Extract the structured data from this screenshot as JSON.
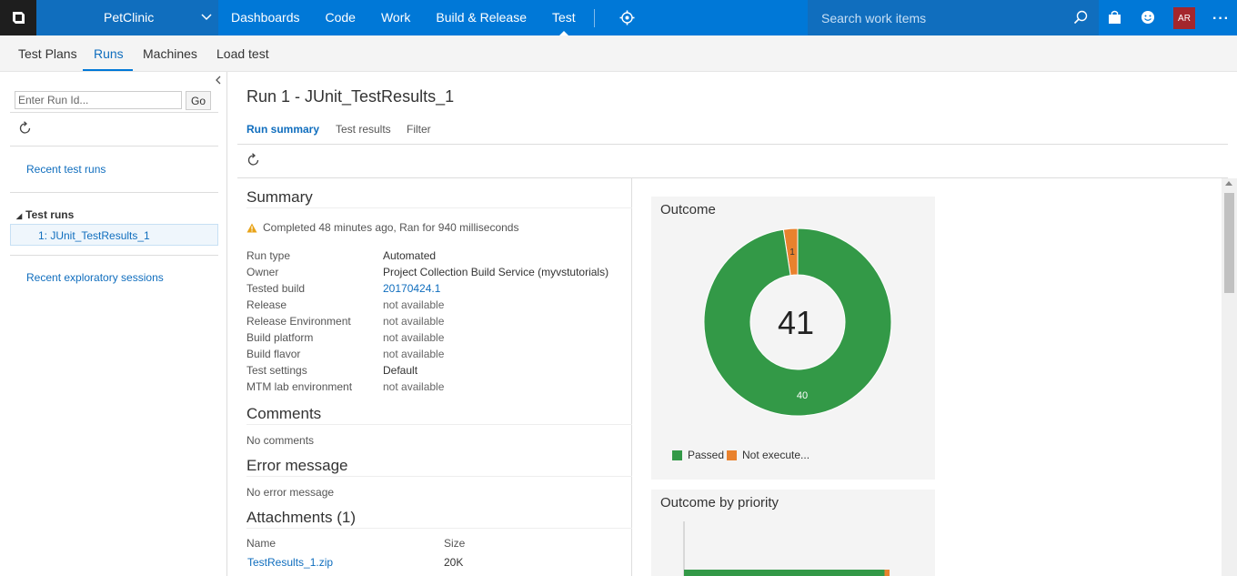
{
  "topbar": {
    "project": "PetClinic",
    "nav": [
      "Dashboards",
      "Code",
      "Work",
      "Build & Release",
      "Test"
    ],
    "active_nav": "Test",
    "search_placeholder": "Search work items",
    "avatar_initials": "AR"
  },
  "subnav": {
    "items": [
      "Test Plans",
      "Runs",
      "Machines",
      "Load test"
    ],
    "active": "Runs"
  },
  "left": {
    "run_id_placeholder": "Enter Run Id...",
    "go_label": "Go",
    "recent_test_runs": "Recent test runs",
    "test_runs_header": "Test runs",
    "selected_run": "1: JUnit_TestResults_1",
    "recent_exploratory": "Recent exploratory sessions"
  },
  "main": {
    "title": "Run 1 - JUnit_TestResults_1",
    "tabs": [
      "Run summary",
      "Test results",
      "Filter"
    ],
    "active_tab": "Run summary",
    "summary": {
      "heading": "Summary",
      "status": "Completed 48 minutes ago, Ran for 940 milliseconds",
      "fields": [
        {
          "key": "Run type",
          "value": "Automated"
        },
        {
          "key": "Owner",
          "value": "Project Collection Build Service (myvstutorials)"
        },
        {
          "key": "Tested build",
          "value": "20170424.1"
        },
        {
          "key": "Release",
          "value": "not available"
        },
        {
          "key": "Release Environment",
          "value": "not available"
        },
        {
          "key": "Build platform",
          "value": "not available"
        },
        {
          "key": "Build flavor",
          "value": "not available"
        },
        {
          "key": "Test settings",
          "value": "Default"
        },
        {
          "key": "MTM lab environment",
          "value": "not available"
        }
      ]
    },
    "comments": {
      "heading": "Comments",
      "text": "No comments"
    },
    "error": {
      "heading": "Error message",
      "text": "No error message"
    },
    "attachments": {
      "heading": "Attachments (1)",
      "col_name": "Name",
      "col_size": "Size",
      "rows": [
        {
          "name": "TestResults_1.zip",
          "size": "20K"
        }
      ]
    }
  },
  "charts": {
    "outcome_title": "Outcome",
    "outcome_by_priority_title": "Outcome by priority",
    "colors": {
      "passed": "#339947",
      "not_executed": "#e9822e"
    }
  },
  "chart_data": [
    {
      "type": "pie",
      "title": "Outcome",
      "center_label": "41",
      "categories": [
        "Passed",
        "Not execute..."
      ],
      "values": [
        40,
        1
      ]
    },
    {
      "type": "bar",
      "title": "Outcome by priority",
      "series": [
        {
          "name": "Passed",
          "values": [
            40
          ]
        },
        {
          "name": "Not execute...",
          "values": [
            1
          ]
        }
      ]
    }
  ]
}
